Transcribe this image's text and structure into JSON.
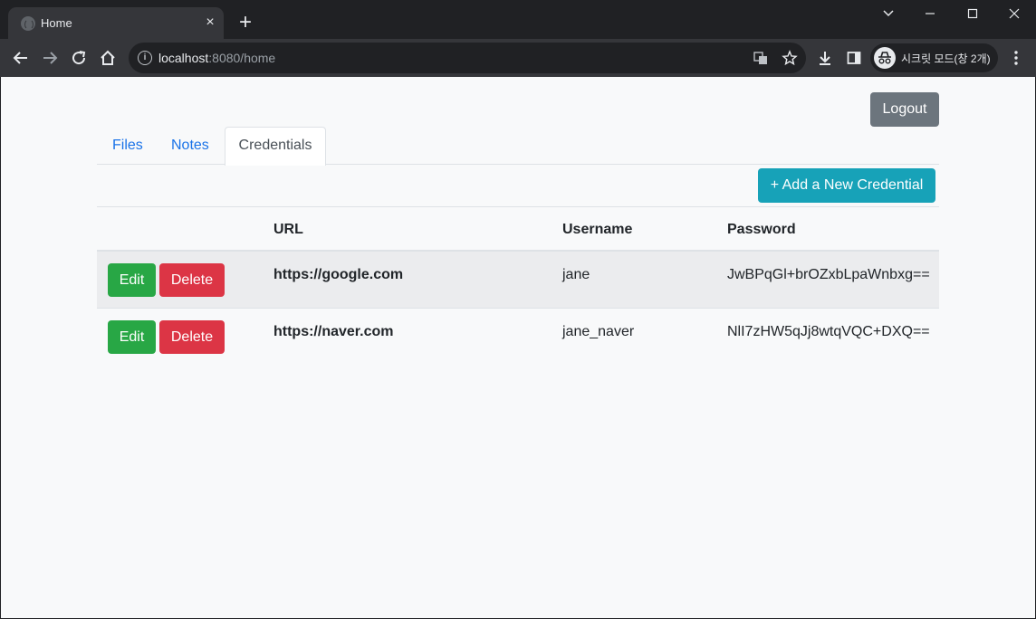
{
  "browser": {
    "tab_title": "Home",
    "tab_close": "×",
    "new_tab": "+",
    "url_host": "localhost",
    "url_rest": ":8080/home",
    "profile_label": "시크릿 모드(창 2개)"
  },
  "page": {
    "logout_label": "Logout",
    "tabs": [
      {
        "label": "Files"
      },
      {
        "label": "Notes"
      },
      {
        "label": "Credentials"
      }
    ],
    "add_button_label": "+ Add a New Credential",
    "table": {
      "headers": [
        "URL",
        "Username",
        "Password"
      ],
      "edit_label": "Edit",
      "delete_label": "Delete",
      "rows": [
        {
          "url": "https://google.com",
          "username": "jane",
          "password": "JwBPqGl+brOZxbLpaWnbxg=="
        },
        {
          "url": "https://naver.com",
          "username": "jane_naver",
          "password": "NlI7zHW5qJj8wtqVQC+DXQ=="
        }
      ]
    }
  },
  "colors": {
    "primary_link": "#1a73e8",
    "logout": "#6c757d",
    "info": "#17a2b8",
    "success": "#28a745",
    "danger": "#dc3545"
  }
}
